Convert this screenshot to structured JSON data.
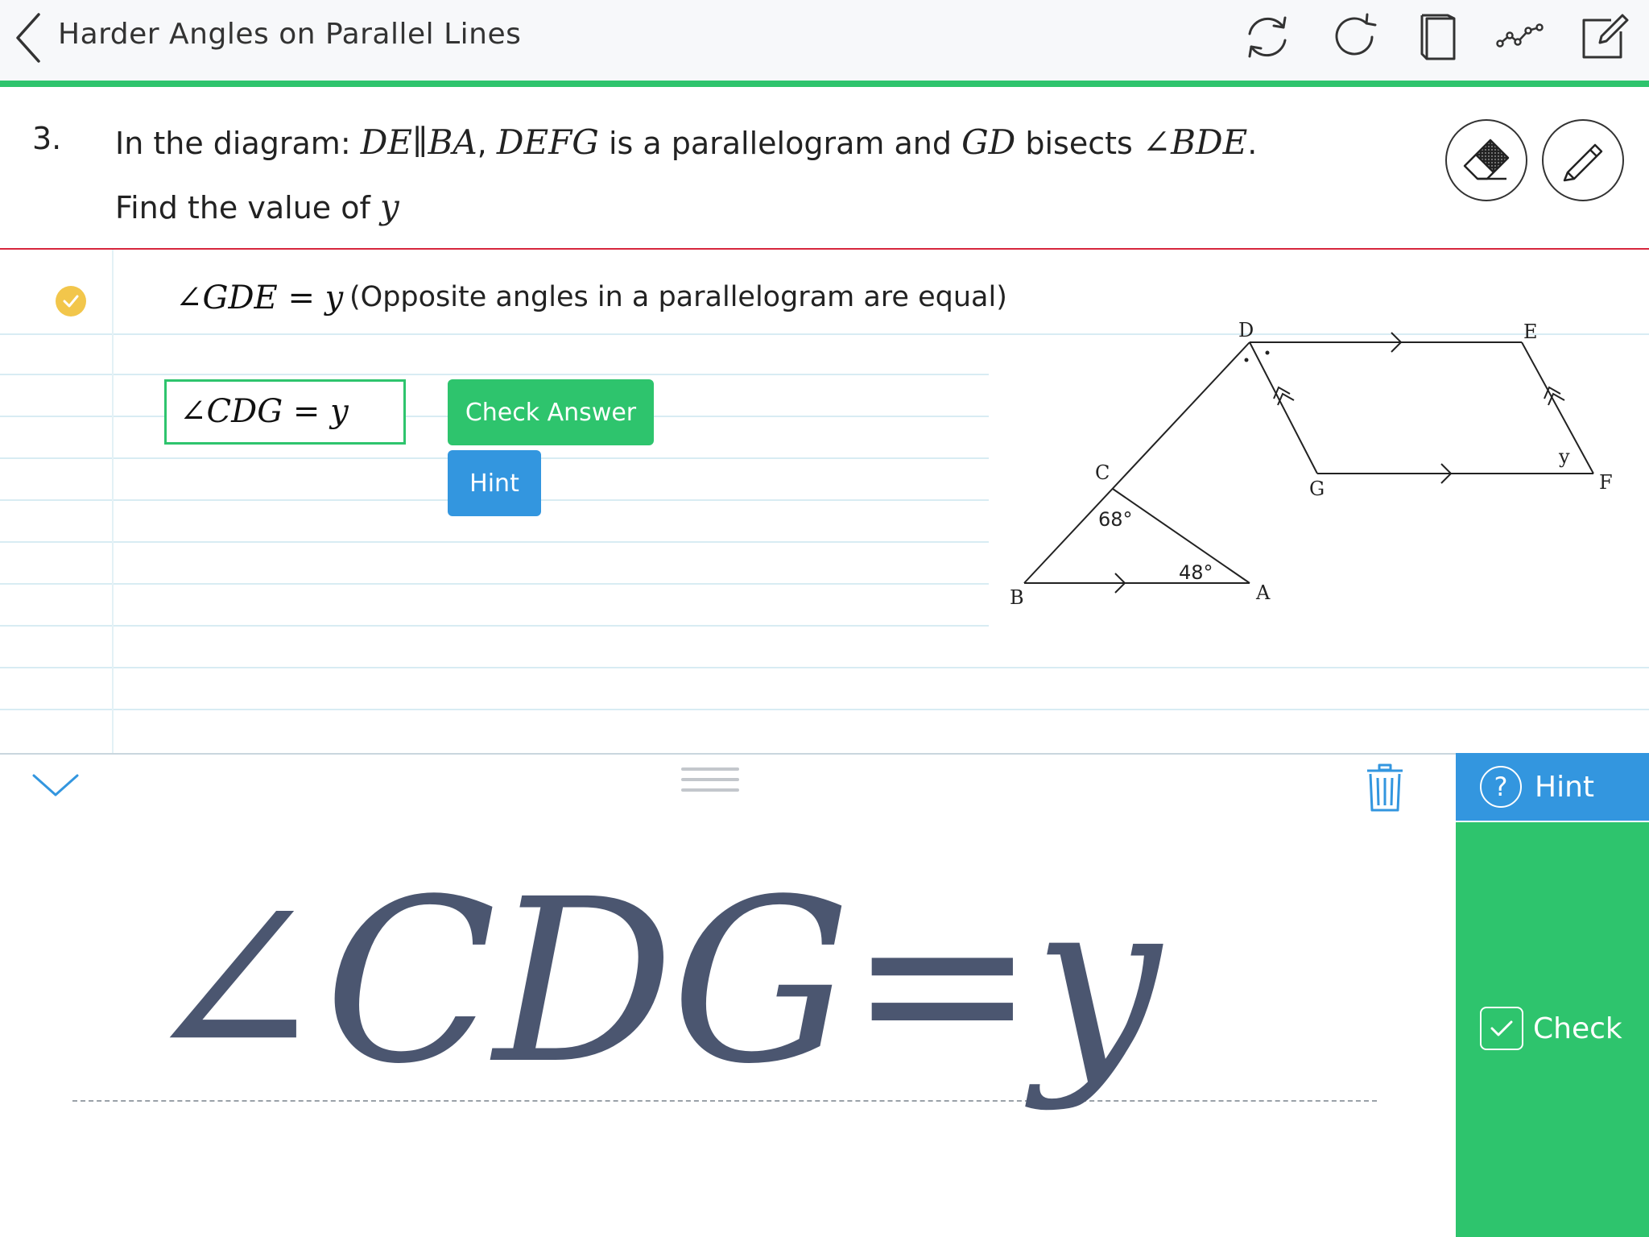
{
  "header": {
    "title": "Harder Angles on Parallel Lines",
    "tools": [
      "restart-icon",
      "redo-icon",
      "notebook-icon",
      "graph-icon",
      "edit-icon"
    ]
  },
  "question": {
    "number": "3.",
    "line1_prefix": "In the diagram: ",
    "dela": "DE∥BA",
    "comma": ", ",
    "defg": "DEFG",
    "mid": " is a parallelogram and ",
    "gd": "GD",
    "bisects": " bisects ",
    "angle_bde": "∠BDE",
    "period": ".",
    "line2_prefix": "Find the value of ",
    "var": "y"
  },
  "step": {
    "math": "∠GDE = y",
    "reason": "(Opposite angles in a parallelogram are equal)"
  },
  "answer": {
    "value": "∠CDG = y",
    "check_label": "Check Answer",
    "hint_label": "Hint"
  },
  "diagram": {
    "labels": {
      "D": "D",
      "E": "E",
      "F": "F",
      "G": "G",
      "C": "C",
      "B": "B",
      "A": "A",
      "y": "y",
      "angle_c": "68°",
      "angle_a": "48°"
    }
  },
  "panel": {
    "hint_label": "Hint",
    "hint_symbol": "?",
    "check_label": "Check",
    "handwriting": "∠CDG=y"
  },
  "colors": {
    "green": "#2ec46d",
    "blue": "#3396df",
    "red_rule": "#d7263d",
    "yellow_check": "#f2c64b",
    "ink": "#4b5670"
  }
}
